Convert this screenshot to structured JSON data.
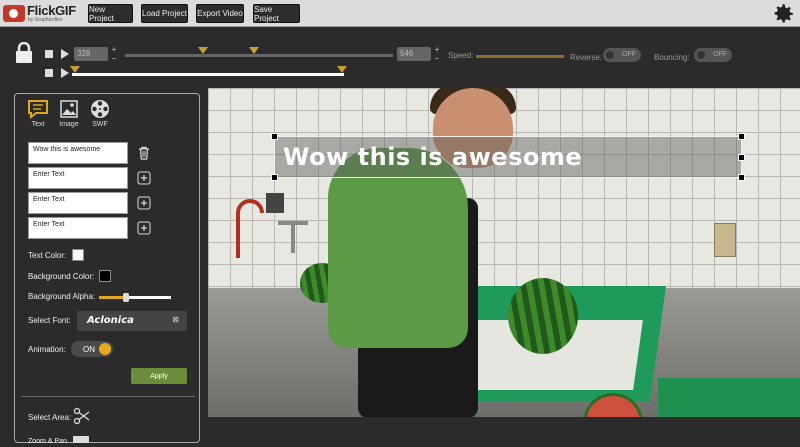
{
  "app": {
    "name": "FlickGIF",
    "tagline": "by Graphicsflex"
  },
  "menu": {
    "new_project": "New Project",
    "load_project": "Load Project",
    "export_video": "Export Video",
    "save_project": "Save Project"
  },
  "timeline": {
    "start_frame": "328",
    "end_frame": "546",
    "speed_label": "Speed:",
    "reverse_label": "Reverse:",
    "reverse_state": "OFF",
    "bouncing_label": "Bouncing:",
    "bouncing_state": "OFF"
  },
  "tools": {
    "text": "Text",
    "image": "Image",
    "swf": "SWF"
  },
  "text_layers": [
    {
      "value": "Wow this is awesome"
    },
    {
      "value": "Enter Text"
    },
    {
      "value": "Enter Text"
    },
    {
      "value": "Enter Text"
    }
  ],
  "settings": {
    "text_color_label": "Text Color:",
    "text_color": "#ffffff",
    "bg_color_label": "Background Color:",
    "bg_color": "#000000",
    "bg_alpha_label": "Background Alpha:",
    "bg_alpha": 0.38,
    "select_font_label": "Select Font:",
    "font_name": "Aclonica",
    "font_clear": "⊠",
    "animation_label": "Animation:",
    "animation_state": "ON",
    "apply_label": "Apply",
    "select_area_label": "Select Area:",
    "zoom_pan_label": "Zoom & Pan"
  },
  "overlay": {
    "text": "Wow this is awesome"
  },
  "colors": {
    "accent": "#e0a820",
    "apply": "#6b8e3a",
    "marker": "#c8a030"
  }
}
